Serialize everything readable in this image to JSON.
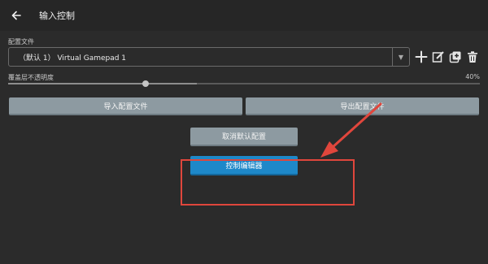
{
  "topbar": {
    "title": "输入控制",
    "back_icon": "arrow-left-icon"
  },
  "profile": {
    "label": "配置文件",
    "selected": "（默认 1） Virtual Gamepad 1"
  },
  "toolbar_icons": [
    "plus-icon",
    "edit-icon",
    "duplicate-icon",
    "trash-icon"
  ],
  "opacity": {
    "label": "覆盖层不透明度",
    "value_text": "40%",
    "level_percent": 40
  },
  "buttons": {
    "import": "导入配置文件",
    "export": "导出配置文件",
    "cancel_default": "取消默认配置",
    "controls_editor": "控制编辑器"
  },
  "colors": {
    "background": "#2b2b2b",
    "primary_button": "#1e88c9",
    "secondary_button": "#8d9aa1",
    "annotation": "#e0463c"
  }
}
